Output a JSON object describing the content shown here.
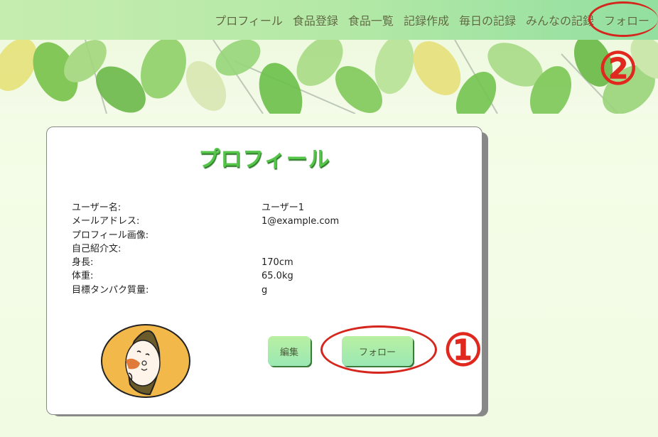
{
  "nav": {
    "items": [
      {
        "label": "プロフィール"
      },
      {
        "label": "食品登録"
      },
      {
        "label": "食品一覧"
      },
      {
        "label": "記録作成"
      },
      {
        "label": "毎日の記録"
      },
      {
        "label": "みんなの記録"
      },
      {
        "label": "フォロー"
      }
    ]
  },
  "profile": {
    "title": "プロフィール",
    "fields": [
      {
        "label": "ユーザー名:",
        "value": "ユーザー1"
      },
      {
        "label": "メールアドレス:",
        "value": "1@example.com"
      },
      {
        "label": "プロフィール画像:",
        "value": ""
      },
      {
        "label": "自己紹介文:",
        "value": ""
      },
      {
        "label": "身長:",
        "value": "170cm"
      },
      {
        "label": "体重:",
        "value": "65.0kg"
      },
      {
        "label": "目標タンパク質量:",
        "value": "g"
      }
    ],
    "edit_label": "編集",
    "follow_label": "フォロー"
  },
  "annotations": {
    "marker_1": "①",
    "marker_2": "②",
    "color": "#d4261c"
  },
  "colors": {
    "title_green": "#55c54a",
    "nav_bg": "#b2e8a6"
  }
}
